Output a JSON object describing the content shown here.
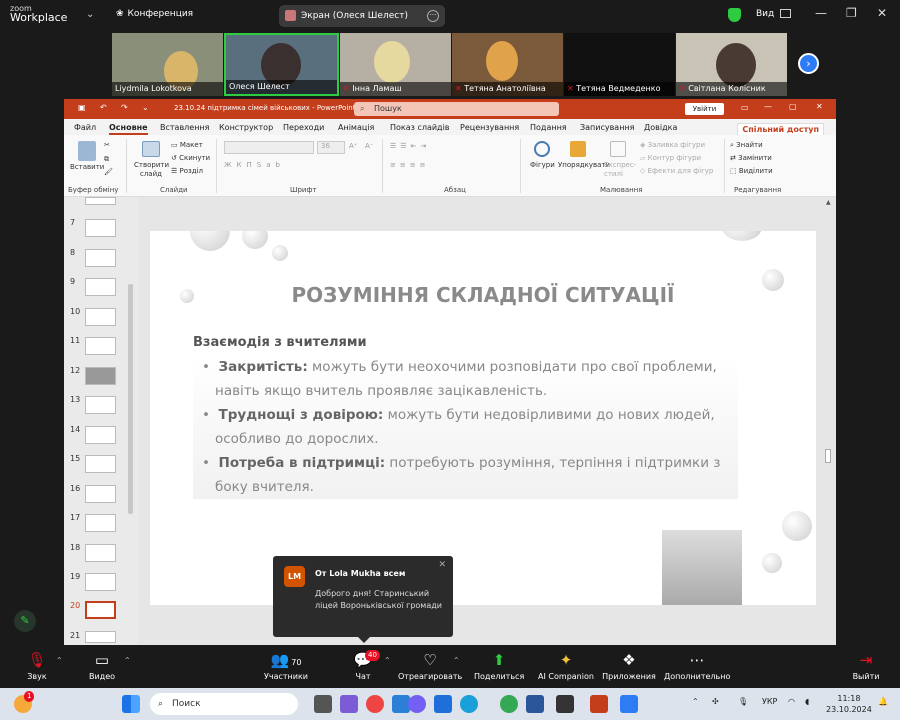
{
  "zoom": {
    "logo_line1": "zoom",
    "logo_line2": "Workplace",
    "conference_label": "Конференция",
    "screen_share_label": "Экран (Олеся Шелест)",
    "view_label": "Вид",
    "participants": [
      {
        "name": "Liydmila Lokotkova",
        "muted": false
      },
      {
        "name": "Олеся Шелест",
        "muted": false,
        "active": true
      },
      {
        "name": "Інна Ламаш",
        "muted": true
      },
      {
        "name": "Тетяна Анатоліївна",
        "muted": true
      },
      {
        "name": "Тетяна Ведмеденко",
        "muted": true
      },
      {
        "name": "Світлана Колісник",
        "muted": true
      }
    ],
    "toolbar": {
      "sound": "Звук",
      "video": "Видео",
      "participants": "Участники",
      "participants_count": "70",
      "chat": "Чат",
      "chat_badge": "40",
      "react": "Отреагировать",
      "share": "Поделиться",
      "ai": "AI Companion",
      "apps": "Приложения",
      "more": "Дополнительно",
      "leave": "Выйти"
    },
    "chat_toast": {
      "avatar": "LM",
      "from": "От Lola Mukha всем",
      "message": "Доброго дня! Старинський ліцей Вороньківської громади"
    }
  },
  "ppt": {
    "window_title": "23.10.24 підтримка сімей військових  -  PowerPoint",
    "search_placeholder": "Пошук",
    "login_button": "Увійти",
    "menu": [
      "Файл",
      "Основне",
      "Вставлення",
      "Конструктор",
      "Переходи",
      "Анімація",
      "Показ слайдів",
      "Рецензування",
      "Подання",
      "Записування",
      "Довідка"
    ],
    "selected_menu": "Основне",
    "share_label": "Спільний доступ",
    "ribbon": {
      "paste": "Вставити",
      "clipboard_group": "Буфер обміну",
      "new_slide": "Створити слайд",
      "layout": "Макет",
      "reset": "Скинути",
      "section": "Розділ",
      "slides_group": "Слайди",
      "font_group": "Шрифт",
      "paragraph_group": "Абзац",
      "shapes": "Фігури",
      "arrange": "Упорядкувати",
      "quick_styles": "Експрес-стилі",
      "fill": "Заливка фігури",
      "outline": "Контур фігури",
      "effects": "Ефекти для фігур",
      "drawing_group": "Малювання",
      "find": "Знайти",
      "replace": "Замінити",
      "select": "Виділити",
      "editing_group": "Редагування",
      "font_size": "36"
    },
    "slide_numbers": [
      "7",
      "8",
      "9",
      "10",
      "11",
      "12",
      "13",
      "14",
      "15",
      "16",
      "17",
      "18",
      "19",
      "20",
      "21"
    ],
    "selected_slide": "20",
    "slide": {
      "title": "РОЗУМІННЯ СКЛАДНОЇ СИТУАЦІЇ",
      "subtitle": "Взаємодія з вчителями",
      "bullets": [
        {
          "bold": "Закритість:",
          "text": " можуть бути неохочими розповідати про свої проблеми, навіть якщо вчитель проявляє зацікавленість."
        },
        {
          "bold": "Труднощі з довірою:",
          "text": " можуть бути недовірливими до нових людей, особливо до дорослих."
        },
        {
          "bold": "Потреба в підтримці:",
          "text": " потребують розуміння, терпіння і підтримки з боку вчителя."
        }
      ]
    }
  },
  "taskbar": {
    "search_placeholder": "Поиск",
    "lang": "УКР",
    "time": "11:18",
    "date": "23.10.2024",
    "notification_badge": "1"
  },
  "colors": {
    "ppt_accent": "#c43e1c",
    "zoom_green": "#2ecc40",
    "zoom_blue": "#2d7cf6"
  }
}
